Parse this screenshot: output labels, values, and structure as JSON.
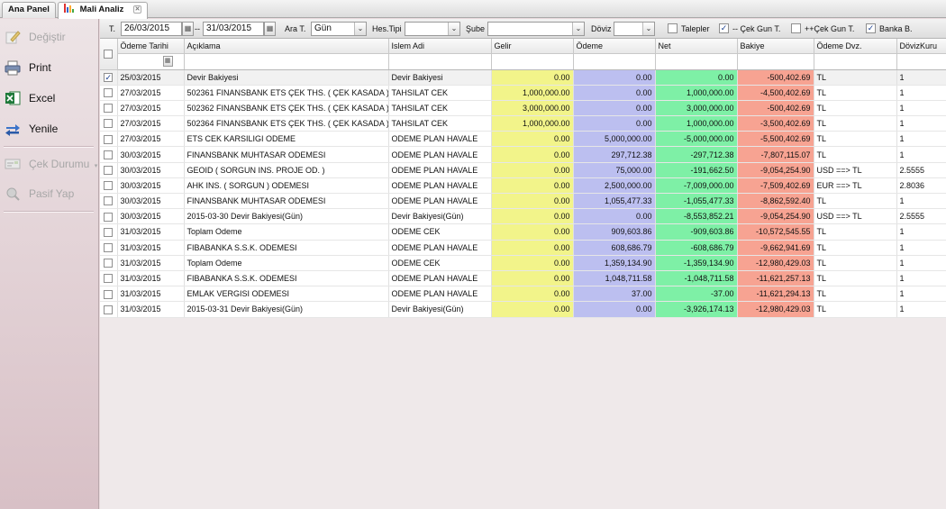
{
  "tabs": [
    {
      "label": "Ana Panel",
      "active": false
    },
    {
      "label": "Mali Analiz",
      "active": true
    }
  ],
  "sidebar": {
    "items": [
      {
        "label": "Değiştir",
        "icon": "edit-icon",
        "disabled": true
      },
      {
        "label": "Print",
        "icon": "printer-icon",
        "disabled": false
      },
      {
        "label": "Excel",
        "icon": "excel-icon",
        "disabled": false
      },
      {
        "label": "Yenile",
        "icon": "refresh-icon",
        "disabled": false
      },
      {
        "label": "Çek Durumu",
        "icon": "cheque-status-icon",
        "disabled": true,
        "dropdown": true
      },
      {
        "label": "Pasif Yap",
        "icon": "deactivate-icon",
        "disabled": true
      }
    ]
  },
  "filters": {
    "date_label": "T.",
    "date_from": "26/03/2015",
    "date_sep": "--",
    "date_to": "31/03/2015",
    "ara_label": "Ara T.",
    "ara_value": "Gün",
    "hes_label": "Hes.Tipi",
    "hes_value": "",
    "sube_label": "Şube",
    "sube_value": "",
    "doviz_label": "Döviz",
    "doviz_value": "",
    "talepler_label": "Talepler",
    "talepler_checked": false,
    "cek_minus_label": "-- Çek Gun T.",
    "cek_minus_checked": true,
    "cek_plus_label": "++Çek Gun T.",
    "cek_plus_checked": false,
    "banka_label": "Banka B.",
    "banka_checked": true
  },
  "grid": {
    "columns": [
      "Ödeme Tarihi",
      "Açıklama",
      "Islem Adi",
      "Gelir",
      "Ödeme",
      "Net",
      "Bakiye",
      "Ödeme Dvz.",
      "DövizKuru"
    ],
    "rows": [
      {
        "checked": true,
        "tarih": "25/03/2015",
        "aciklama": "Devir Bakiyesi",
        "islem": "Devir Bakiyesi",
        "gelir": "0.00",
        "odeme": "0.00",
        "net": "0.00",
        "bakiye": "-500,402.69",
        "dvz": "TL",
        "kur": "1"
      },
      {
        "checked": false,
        "tarih": "27/03/2015",
        "aciklama": "502361 FINANSBANK ETS ÇEK THS. ( ÇEK KASADA )",
        "islem": "TAHSILAT CEK",
        "gelir": "1,000,000.00",
        "odeme": "0.00",
        "net": "1,000,000.00",
        "bakiye": "-4,500,402.69",
        "dvz": "TL",
        "kur": "1"
      },
      {
        "checked": false,
        "tarih": "27/03/2015",
        "aciklama": "502362 FINANSBANK ETS ÇEK THS. ( ÇEK KASADA )",
        "islem": "TAHSILAT CEK",
        "gelir": "3,000,000.00",
        "odeme": "0.00",
        "net": "3,000,000.00",
        "bakiye": "-500,402.69",
        "dvz": "TL",
        "kur": "1"
      },
      {
        "checked": false,
        "tarih": "27/03/2015",
        "aciklama": "502364 FINANSBANK ETS ÇEK THS. ( ÇEK KASADA )",
        "islem": "TAHSILAT CEK",
        "gelir": "1,000,000.00",
        "odeme": "0.00",
        "net": "1,000,000.00",
        "bakiye": "-3,500,402.69",
        "dvz": "TL",
        "kur": "1"
      },
      {
        "checked": false,
        "tarih": "27/03/2015",
        "aciklama": "ETS CEK KARSILIGI ODEME",
        "islem": "ODEME PLAN HAVALE",
        "gelir": "0.00",
        "odeme": "5,000,000.00",
        "net": "-5,000,000.00",
        "bakiye": "-5,500,402.69",
        "dvz": "TL",
        "kur": "1"
      },
      {
        "checked": false,
        "tarih": "30/03/2015",
        "aciklama": "FINANSBANK MUHTASAR ODEMESI",
        "islem": "ODEME PLAN HAVALE",
        "gelir": "0.00",
        "odeme": "297,712.38",
        "net": "-297,712.38",
        "bakiye": "-7,807,115.07",
        "dvz": "TL",
        "kur": "1"
      },
      {
        "checked": false,
        "tarih": "30/03/2015",
        "aciklama": "GEOID ( SORGUN INS. PROJE OD. )",
        "islem": "ODEME PLAN HAVALE",
        "gelir": "0.00",
        "odeme": "75,000.00",
        "net": "-191,662.50",
        "bakiye": "-9,054,254.90",
        "dvz": "USD ==> TL",
        "kur": "2.5555"
      },
      {
        "checked": false,
        "tarih": "30/03/2015",
        "aciklama": "AHK INS. ( SORGUN ) ODEMESI",
        "islem": "ODEME PLAN HAVALE",
        "gelir": "0.00",
        "odeme": "2,500,000.00",
        "net": "-7,009,000.00",
        "bakiye": "-7,509,402.69",
        "dvz": "EUR ==> TL",
        "kur": "2.8036"
      },
      {
        "checked": false,
        "tarih": "30/03/2015",
        "aciklama": "FINANSBANK MUHTASAR ODEMESI",
        "islem": "ODEME PLAN HAVALE",
        "gelir": "0.00",
        "odeme": "1,055,477.33",
        "net": "-1,055,477.33",
        "bakiye": "-8,862,592.40",
        "dvz": "TL",
        "kur": "1"
      },
      {
        "checked": false,
        "tarih": "30/03/2015",
        "aciklama": "2015-03-30 Devir Bakiyesi(Gün)",
        "islem": "Devir Bakiyesi(Gün)",
        "gelir": "0.00",
        "odeme": "0.00",
        "net": "-8,553,852.21",
        "bakiye": "-9,054,254.90",
        "dvz": "USD ==> TL",
        "kur": "2.5555"
      },
      {
        "checked": false,
        "tarih": "31/03/2015",
        "aciklama": "Toplam Odeme",
        "islem": "ODEME CEK",
        "gelir": "0.00",
        "odeme": "909,603.86",
        "net": "-909,603.86",
        "bakiye": "-10,572,545.55",
        "dvz": "TL",
        "kur": "1"
      },
      {
        "checked": false,
        "tarih": "31/03/2015",
        "aciklama": "FIBABANKA S.S.K. ODEMESI",
        "islem": "ODEME PLAN HAVALE",
        "gelir": "0.00",
        "odeme": "608,686.79",
        "net": "-608,686.79",
        "bakiye": "-9,662,941.69",
        "dvz": "TL",
        "kur": "1"
      },
      {
        "checked": false,
        "tarih": "31/03/2015",
        "aciklama": "Toplam Odeme",
        "islem": "ODEME CEK",
        "gelir": "0.00",
        "odeme": "1,359,134.90",
        "net": "-1,359,134.90",
        "bakiye": "-12,980,429.03",
        "dvz": "TL",
        "kur": "1"
      },
      {
        "checked": false,
        "tarih": "31/03/2015",
        "aciklama": "FIBABANKA S.S.K. ODEMESI",
        "islem": "ODEME PLAN HAVALE",
        "gelir": "0.00",
        "odeme": "1,048,711.58",
        "net": "-1,048,711.58",
        "bakiye": "-11,621,257.13",
        "dvz": "TL",
        "kur": "1"
      },
      {
        "checked": false,
        "tarih": "31/03/2015",
        "aciklama": "EMLAK VERGISI ODEMESI",
        "islem": "ODEME PLAN HAVALE",
        "gelir": "0.00",
        "odeme": "37.00",
        "net": "-37.00",
        "bakiye": "-11,621,294.13",
        "dvz": "TL",
        "kur": "1"
      },
      {
        "checked": false,
        "tarih": "31/03/2015",
        "aciklama": "2015-03-31 Devir Bakiyesi(Gün)",
        "islem": "Devir Bakiyesi(Gün)",
        "gelir": "0.00",
        "odeme": "0.00",
        "net": "-3,926,174.13",
        "bakiye": "-12,980,429.03",
        "dvz": "TL",
        "kur": "1"
      }
    ]
  },
  "colors": {
    "gelir": "#f2f48a",
    "odeme": "#bcbff0",
    "net": "#7ef0a6",
    "bakiye": "#f7a392",
    "sidebar": "#e2cfd3"
  }
}
